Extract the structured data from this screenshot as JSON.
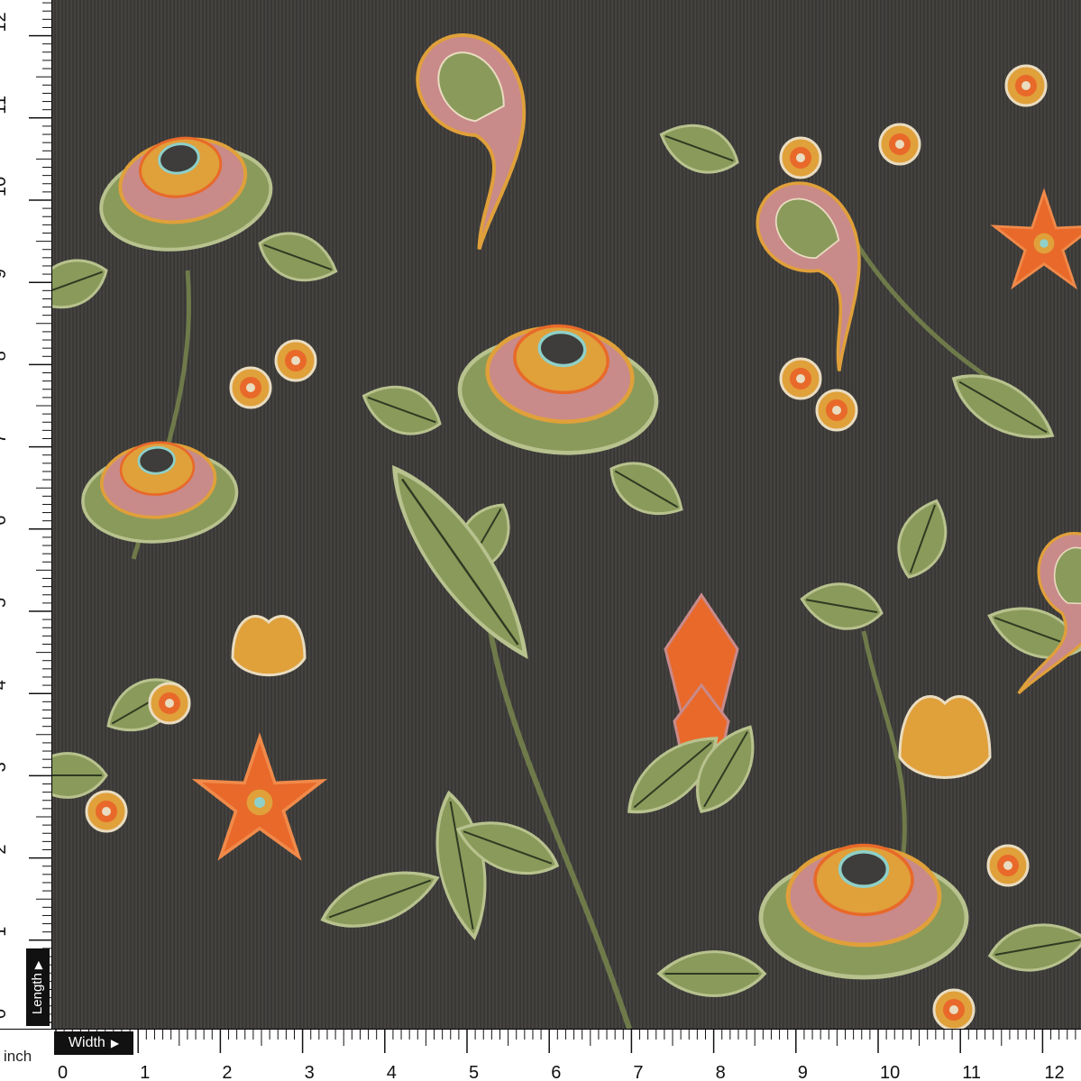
{
  "ruler": {
    "unit": "inch",
    "width_label": "Width",
    "length_label": "Length",
    "x_ticks": [
      "0",
      "1",
      "2",
      "3",
      "4",
      "5",
      "6",
      "7",
      "8",
      "9",
      "10",
      "11",
      "12"
    ],
    "y_ticks": [
      "0",
      "1",
      "2",
      "3",
      "4",
      "5",
      "6",
      "7",
      "8",
      "9",
      "10",
      "11",
      "12"
    ]
  },
  "fabric": {
    "background_color": "#3e3d3b",
    "palette": {
      "orange": "#e8692a",
      "mustard": "#e0a03a",
      "olive": "#8a9a5b",
      "sage": "#b8c28e",
      "rose": "#c98a8a",
      "cream": "#e9dcc0",
      "aqua": "#8fd0c8"
    }
  }
}
